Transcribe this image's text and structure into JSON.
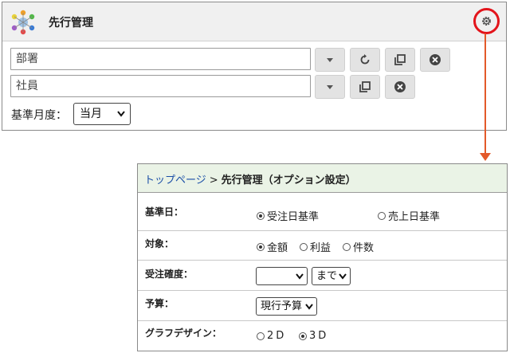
{
  "panel": {
    "title": "先行管理",
    "department_placeholder": "部署",
    "employee_placeholder": "社員",
    "month_label": "基準月度：",
    "month_value": "当月",
    "settings_icon": "gear-icon",
    "highlight_color": "#e3141b"
  },
  "dialog": {
    "breadcrumb": {
      "link": "トップページ",
      "separator": ">",
      "current": "先行管理（オプション設定）"
    },
    "base_date": {
      "label": "基準日：",
      "options": [
        "受注日基準",
        "売上日基準"
      ],
      "selected": "受注日基準"
    },
    "target": {
      "label": "対象：",
      "options": [
        "金額",
        "利益",
        "件数"
      ],
      "selected": "金額"
    },
    "order_certainty": {
      "label": "受注確度：",
      "value": "",
      "until": "まで"
    },
    "budget": {
      "label": "予算：",
      "value": "現行予算"
    },
    "graph_design": {
      "label": "グラフデザイン：",
      "options": [
        "2D",
        "3D"
      ],
      "selected": "3D"
    }
  }
}
